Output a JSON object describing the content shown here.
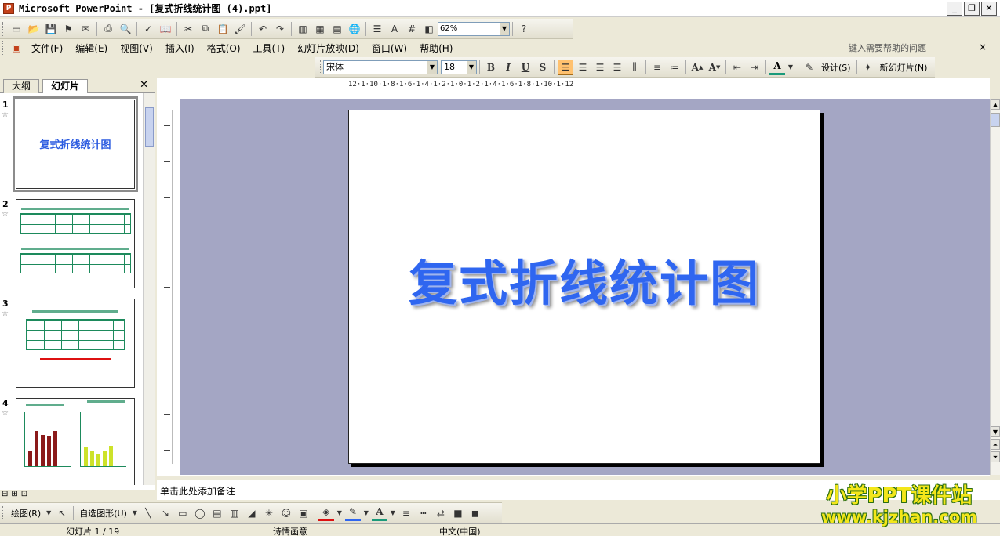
{
  "window": {
    "title": "Microsoft PowerPoint - [复式折线统计图 (4).ppt]"
  },
  "standard_toolbar": {
    "zoom": "62%"
  },
  "menu": {
    "items": [
      "文件(F)",
      "编辑(E)",
      "视图(V)",
      "插入(I)",
      "格式(O)",
      "工具(T)",
      "幻灯片放映(D)",
      "窗口(W)",
      "帮助(H)"
    ]
  },
  "help": {
    "placeholder": "键入需要帮助的问题"
  },
  "format_toolbar": {
    "font": "宋体",
    "size": "18",
    "bold": "B",
    "italic": "I",
    "underline": "U",
    "shadow": "S",
    "design": "设计(S)",
    "new_slide": "新幻灯片(N)"
  },
  "left_pane": {
    "tab_outline": "大纲",
    "tab_slides": "幻灯片",
    "slides": [
      {
        "num": "1",
        "title": "复式折线统计图"
      },
      {
        "num": "2"
      },
      {
        "num": "3"
      },
      {
        "num": "4"
      }
    ]
  },
  "ruler": {
    "h_labels": "12·1·10·1·8·1·6·1·4·1·2·1·0·1·2·1·4·1·6·1·8·1·10·1·12"
  },
  "slide": {
    "title": "复式折线统计图"
  },
  "notes": {
    "placeholder": "单击此处添加备注"
  },
  "drawing_toolbar": {
    "draw": "绘图(R)",
    "autoshapes": "自选图形(U)"
  },
  "status": {
    "slide_pos": "幻灯片 1 / 19",
    "design": "诗情画意",
    "language": "中文(中国)"
  },
  "watermark": {
    "line1": "小学PPT课件站",
    "line2": "www.kjzhan.com"
  }
}
